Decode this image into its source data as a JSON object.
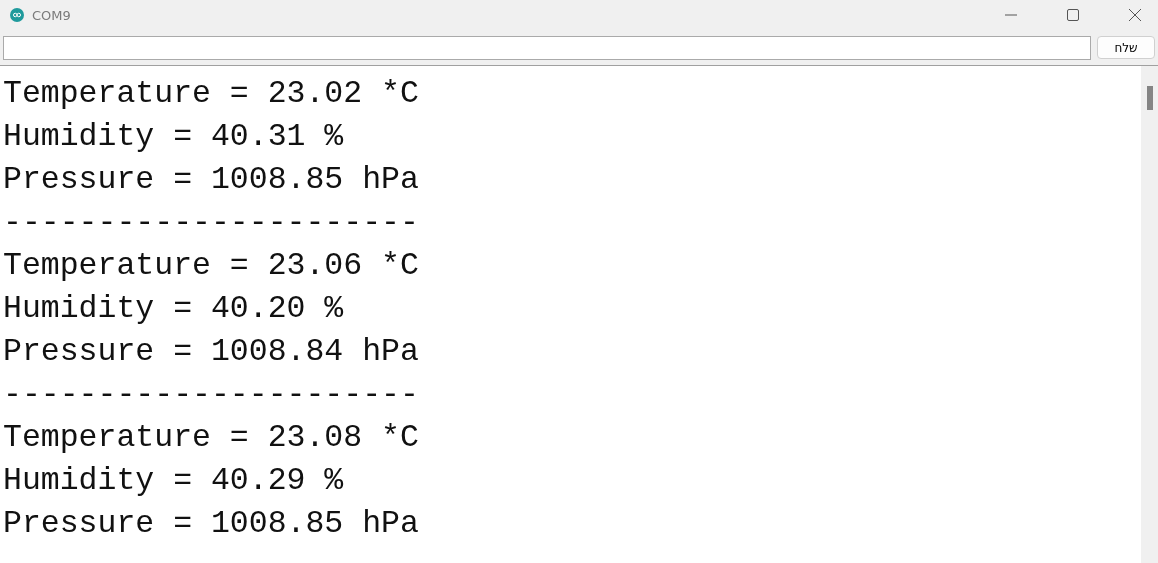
{
  "window": {
    "title": "COM9"
  },
  "send_button": {
    "label": "שלח"
  },
  "output_lines": [
    "Temperature = 23.02 *C",
    "Humidity = 40.31 %",
    "Pressure = 1008.85 hPa",
    "----------------------",
    "Temperature = 23.06 *C",
    "Humidity = 40.20 %",
    "Pressure = 1008.84 hPa",
    "----------------------",
    "Temperature = 23.08 *C",
    "Humidity = 40.29 %",
    "Pressure = 1008.85 hPa"
  ]
}
